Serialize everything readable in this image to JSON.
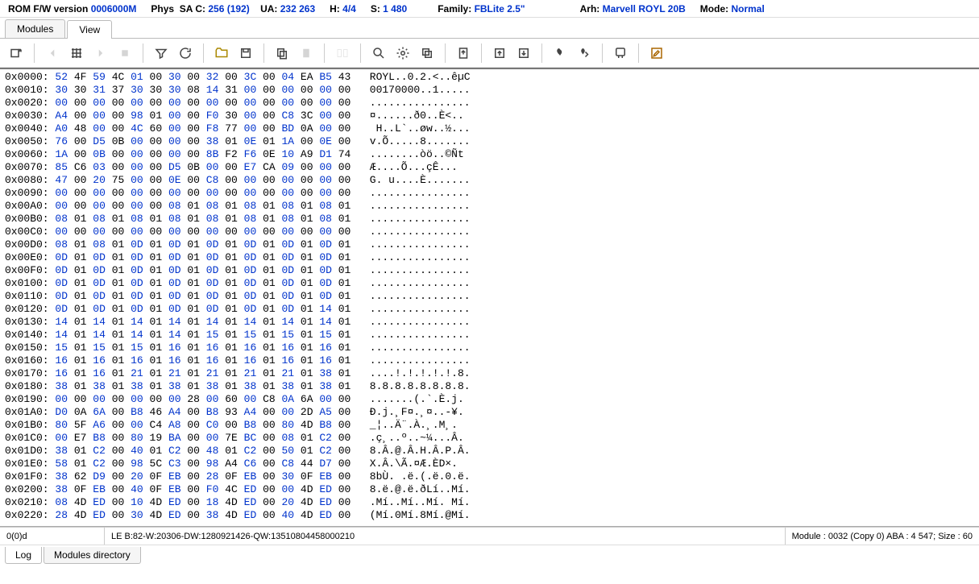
{
  "header": {
    "rom_label": "ROM F/W version",
    "rom_val": "0006000M",
    "phys_label": "Phys",
    "sa_c_label": "SA C:",
    "sa_c_val": "256 (192)",
    "ua_label": "UA:",
    "ua_val": "232 263",
    "h_label": "H:",
    "h_val": "4/4",
    "s_label": "S:",
    "s_val": "1 480",
    "family_label": "Family:",
    "family_val": "FBLite 2.5\"",
    "arh_label": "Arh:",
    "arh_val": "Marvell ROYL 20B",
    "mode_label": "Mode:",
    "mode_val": "Normal"
  },
  "tabs": {
    "modules": "Modules",
    "view": "View"
  },
  "hex_rows": [
    {
      "addr": "0x0000:",
      "bytes": [
        [
          "52",
          "4F"
        ],
        [
          "59",
          "4C"
        ],
        [
          "01",
          "00"
        ],
        [
          "30",
          "00"
        ],
        [
          "32",
          "00"
        ],
        [
          "3C",
          "00"
        ],
        [
          "04",
          "EA"
        ],
        [
          "B5",
          "43"
        ]
      ],
      "ascii": "ROYL..0.2.<..êµC"
    },
    {
      "addr": "0x0010:",
      "bytes": [
        [
          "30",
          "30"
        ],
        [
          "31",
          "37"
        ],
        [
          "30",
          "30"
        ],
        [
          "30",
          "08"
        ],
        [
          "14",
          "31"
        ],
        [
          "00",
          "00"
        ],
        [
          "00",
          "00"
        ],
        [
          "00",
          "00"
        ]
      ],
      "ascii": "00170000..1....."
    },
    {
      "addr": "0x0020:",
      "bytes": [
        [
          "00",
          "00"
        ],
        [
          "00",
          "00"
        ],
        [
          "00",
          "00"
        ],
        [
          "00",
          "00"
        ],
        [
          "00",
          "00"
        ],
        [
          "00",
          "00"
        ],
        [
          "00",
          "00"
        ],
        [
          "00",
          "00"
        ]
      ],
      "ascii": "................"
    },
    {
      "addr": "0x0030:",
      "bytes": [
        [
          "A4",
          "00"
        ],
        [
          "00",
          "00"
        ],
        [
          "98",
          "01"
        ],
        [
          "00",
          "00"
        ],
        [
          "F0",
          "30"
        ],
        [
          "00",
          "00"
        ],
        [
          "C8",
          "3C"
        ],
        [
          "00",
          "00"
        ]
      ],
      "ascii": "¤......ð0..È<.."
    },
    {
      "addr": "0x0040:",
      "bytes": [
        [
          "A0",
          "48"
        ],
        [
          "00",
          "00"
        ],
        [
          "4C",
          "60"
        ],
        [
          "00",
          "00"
        ],
        [
          "F8",
          "77"
        ],
        [
          "00",
          "00"
        ],
        [
          "BD",
          "0A"
        ],
        [
          "00",
          "00"
        ]
      ],
      "ascii": " H..L`..øw..½..."
    },
    {
      "addr": "0x0050:",
      "bytes": [
        [
          "76",
          "00"
        ],
        [
          "D5",
          "0B"
        ],
        [
          "00",
          "00"
        ],
        [
          "00",
          "00"
        ],
        [
          "38",
          "01"
        ],
        [
          "0E",
          "01"
        ],
        [
          "1A",
          "00"
        ],
        [
          "0E",
          "00"
        ]
      ],
      "ascii": "v.Õ.....8......."
    },
    {
      "addr": "0x0060:",
      "bytes": [
        [
          "1A",
          "00"
        ],
        [
          "0B",
          "00"
        ],
        [
          "00",
          "00"
        ],
        [
          "00",
          "00"
        ],
        [
          "8B",
          "F2"
        ],
        [
          "F6",
          "0E"
        ],
        [
          "10",
          "A9"
        ],
        [
          "D1",
          "74"
        ]
      ],
      "ascii": "........òö..©Ñt"
    },
    {
      "addr": "0x0070:",
      "bytes": [
        [
          "85",
          "C6"
        ],
        [
          "03",
          "00"
        ],
        [
          "00",
          "00"
        ],
        [
          "D5",
          "0B"
        ],
        [
          "00",
          "00"
        ],
        [
          "E7",
          "CA"
        ],
        [
          "09",
          "00"
        ],
        [
          "00",
          "00"
        ]
      ],
      "ascii": "Æ....Õ...çÊ..."
    },
    {
      "addr": "0x0080:",
      "bytes": [
        [
          "47",
          "00"
        ],
        [
          "20",
          "75"
        ],
        [
          "00",
          "00"
        ],
        [
          "0E",
          "00"
        ],
        [
          "C8",
          "00"
        ],
        [
          "00",
          "00"
        ],
        [
          "00",
          "00"
        ],
        [
          "00",
          "00"
        ]
      ],
      "ascii": "G. u....È......."
    },
    {
      "addr": "0x0090:",
      "bytes": [
        [
          "00",
          "00"
        ],
        [
          "00",
          "00"
        ],
        [
          "00",
          "00"
        ],
        [
          "00",
          "00"
        ],
        [
          "00",
          "00"
        ],
        [
          "00",
          "00"
        ],
        [
          "00",
          "00"
        ],
        [
          "00",
          "00"
        ]
      ],
      "ascii": "................"
    },
    {
      "addr": "0x00A0:",
      "bytes": [
        [
          "00",
          "00"
        ],
        [
          "00",
          "00"
        ],
        [
          "00",
          "00"
        ],
        [
          "08",
          "01"
        ],
        [
          "08",
          "01"
        ],
        [
          "08",
          "01"
        ],
        [
          "08",
          "01"
        ],
        [
          "08",
          "01"
        ]
      ],
      "ascii": "................"
    },
    {
      "addr": "0x00B0:",
      "bytes": [
        [
          "08",
          "01"
        ],
        [
          "08",
          "01"
        ],
        [
          "08",
          "01"
        ],
        [
          "08",
          "01"
        ],
        [
          "08",
          "01"
        ],
        [
          "08",
          "01"
        ],
        [
          "08",
          "01"
        ],
        [
          "08",
          "01"
        ]
      ],
      "ascii": "................"
    },
    {
      "addr": "0x00C0:",
      "bytes": [
        [
          "00",
          "00"
        ],
        [
          "00",
          "00"
        ],
        [
          "00",
          "00"
        ],
        [
          "00",
          "00"
        ],
        [
          "00",
          "00"
        ],
        [
          "00",
          "00"
        ],
        [
          "00",
          "00"
        ],
        [
          "00",
          "00"
        ]
      ],
      "ascii": "................"
    },
    {
      "addr": "0x00D0:",
      "bytes": [
        [
          "08",
          "01"
        ],
        [
          "08",
          "01"
        ],
        [
          "0D",
          "01"
        ],
        [
          "0D",
          "01"
        ],
        [
          "0D",
          "01"
        ],
        [
          "0D",
          "01"
        ],
        [
          "0D",
          "01"
        ],
        [
          "0D",
          "01"
        ]
      ],
      "ascii": "................"
    },
    {
      "addr": "0x00E0:",
      "bytes": [
        [
          "0D",
          "01"
        ],
        [
          "0D",
          "01"
        ],
        [
          "0D",
          "01"
        ],
        [
          "0D",
          "01"
        ],
        [
          "0D",
          "01"
        ],
        [
          "0D",
          "01"
        ],
        [
          "0D",
          "01"
        ],
        [
          "0D",
          "01"
        ]
      ],
      "ascii": "................"
    },
    {
      "addr": "0x00F0:",
      "bytes": [
        [
          "0D",
          "01"
        ],
        [
          "0D",
          "01"
        ],
        [
          "0D",
          "01"
        ],
        [
          "0D",
          "01"
        ],
        [
          "0D",
          "01"
        ],
        [
          "0D",
          "01"
        ],
        [
          "0D",
          "01"
        ],
        [
          "0D",
          "01"
        ]
      ],
      "ascii": "................"
    },
    {
      "addr": "0x0100:",
      "bytes": [
        [
          "0D",
          "01"
        ],
        [
          "0D",
          "01"
        ],
        [
          "0D",
          "01"
        ],
        [
          "0D",
          "01"
        ],
        [
          "0D",
          "01"
        ],
        [
          "0D",
          "01"
        ],
        [
          "0D",
          "01"
        ],
        [
          "0D",
          "01"
        ]
      ],
      "ascii": "................"
    },
    {
      "addr": "0x0110:",
      "bytes": [
        [
          "0D",
          "01"
        ],
        [
          "0D",
          "01"
        ],
        [
          "0D",
          "01"
        ],
        [
          "0D",
          "01"
        ],
        [
          "0D",
          "01"
        ],
        [
          "0D",
          "01"
        ],
        [
          "0D",
          "01"
        ],
        [
          "0D",
          "01"
        ]
      ],
      "ascii": "................"
    },
    {
      "addr": "0x0120:",
      "bytes": [
        [
          "0D",
          "01"
        ],
        [
          "0D",
          "01"
        ],
        [
          "0D",
          "01"
        ],
        [
          "0D",
          "01"
        ],
        [
          "0D",
          "01"
        ],
        [
          "0D",
          "01"
        ],
        [
          "0D",
          "01"
        ],
        [
          "14",
          "01"
        ]
      ],
      "ascii": "................"
    },
    {
      "addr": "0x0130:",
      "bytes": [
        [
          "14",
          "01"
        ],
        [
          "14",
          "01"
        ],
        [
          "14",
          "01"
        ],
        [
          "14",
          "01"
        ],
        [
          "14",
          "01"
        ],
        [
          "14",
          "01"
        ],
        [
          "14",
          "01"
        ],
        [
          "14",
          "01"
        ]
      ],
      "ascii": "................"
    },
    {
      "addr": "0x0140:",
      "bytes": [
        [
          "14",
          "01"
        ],
        [
          "14",
          "01"
        ],
        [
          "14",
          "01"
        ],
        [
          "14",
          "01"
        ],
        [
          "15",
          "01"
        ],
        [
          "15",
          "01"
        ],
        [
          "15",
          "01"
        ],
        [
          "15",
          "01"
        ]
      ],
      "ascii": "................"
    },
    {
      "addr": "0x0150:",
      "bytes": [
        [
          "15",
          "01"
        ],
        [
          "15",
          "01"
        ],
        [
          "15",
          "01"
        ],
        [
          "16",
          "01"
        ],
        [
          "16",
          "01"
        ],
        [
          "16",
          "01"
        ],
        [
          "16",
          "01"
        ],
        [
          "16",
          "01"
        ]
      ],
      "ascii": "................"
    },
    {
      "addr": "0x0160:",
      "bytes": [
        [
          "16",
          "01"
        ],
        [
          "16",
          "01"
        ],
        [
          "16",
          "01"
        ],
        [
          "16",
          "01"
        ],
        [
          "16",
          "01"
        ],
        [
          "16",
          "01"
        ],
        [
          "16",
          "01"
        ],
        [
          "16",
          "01"
        ]
      ],
      "ascii": "................"
    },
    {
      "addr": "0x0170:",
      "bytes": [
        [
          "16",
          "01"
        ],
        [
          "16",
          "01"
        ],
        [
          "21",
          "01"
        ],
        [
          "21",
          "01"
        ],
        [
          "21",
          "01"
        ],
        [
          "21",
          "01"
        ],
        [
          "21",
          "01"
        ],
        [
          "38",
          "01"
        ]
      ],
      "ascii": "....!.!.!.!.!.8."
    },
    {
      "addr": "0x0180:",
      "bytes": [
        [
          "38",
          "01"
        ],
        [
          "38",
          "01"
        ],
        [
          "38",
          "01"
        ],
        [
          "38",
          "01"
        ],
        [
          "38",
          "01"
        ],
        [
          "38",
          "01"
        ],
        [
          "38",
          "01"
        ],
        [
          "38",
          "01"
        ]
      ],
      "ascii": "8.8.8.8.8.8.8.8."
    },
    {
      "addr": "0x0190:",
      "bytes": [
        [
          "00",
          "00"
        ],
        [
          "00",
          "00"
        ],
        [
          "00",
          "00"
        ],
        [
          "00",
          "28"
        ],
        [
          "00",
          "60"
        ],
        [
          "00",
          "C8"
        ],
        [
          "0A",
          "6A"
        ],
        [
          "00",
          "00"
        ]
      ],
      "ascii": ".......(.`.È.j."
    },
    {
      "addr": "0x01A0:",
      "bytes": [
        [
          "D0",
          "0A"
        ],
        [
          "6A",
          "00"
        ],
        [
          "B8",
          "46"
        ],
        [
          "A4",
          "00"
        ],
        [
          "B8",
          "93"
        ],
        [
          "A4",
          "00"
        ],
        [
          "00",
          "2D"
        ],
        [
          "A5",
          "00"
        ]
      ],
      "ascii": "Ð.j.¸F¤.¸¤..-¥."
    },
    {
      "addr": "0x01B0:",
      "bytes": [
        [
          "80",
          "5F"
        ],
        [
          "A6",
          "00"
        ],
        [
          "00",
          "C4"
        ],
        [
          "A8",
          "00"
        ],
        [
          "C0",
          "00"
        ],
        [
          "B8",
          "00"
        ],
        [
          "80",
          "4D"
        ],
        [
          "B8",
          "00"
        ]
      ],
      "ascii": "_¦..Ä¨.À.¸.M¸."
    },
    {
      "addr": "0x01C0:",
      "bytes": [
        [
          "00",
          "E7"
        ],
        [
          "B8",
          "00"
        ],
        [
          "80",
          "19"
        ],
        [
          "BA",
          "00"
        ],
        [
          "00",
          "7E"
        ],
        [
          "BC",
          "00"
        ],
        [
          "08",
          "01"
        ],
        [
          "C2",
          "00"
        ]
      ],
      "ascii": ".ç¸..º..~¼...Â."
    },
    {
      "addr": "0x01D0:",
      "bytes": [
        [
          "38",
          "01"
        ],
        [
          "C2",
          "00"
        ],
        [
          "40",
          "01"
        ],
        [
          "C2",
          "00"
        ],
        [
          "48",
          "01"
        ],
        [
          "C2",
          "00"
        ],
        [
          "50",
          "01"
        ],
        [
          "C2",
          "00"
        ]
      ],
      "ascii": "8.Â.@.Â.H.Â.P.Â."
    },
    {
      "addr": "0x01E0:",
      "bytes": [
        [
          "58",
          "01"
        ],
        [
          "C2",
          "00"
        ],
        [
          "98",
          "5C"
        ],
        [
          "C3",
          "00"
        ],
        [
          "98",
          "A4"
        ],
        [
          "C6",
          "00"
        ],
        [
          "C8",
          "44"
        ],
        [
          "D7",
          "00"
        ]
      ],
      "ascii": "X.Â.\\Ã.¤Æ.ÈD×."
    },
    {
      "addr": "0x01F0:",
      "bytes": [
        [
          "38",
          "62"
        ],
        [
          "D9",
          "00"
        ],
        [
          "20",
          "0F"
        ],
        [
          "EB",
          "00"
        ],
        [
          "28",
          "0F"
        ],
        [
          "EB",
          "00"
        ],
        [
          "30",
          "0F"
        ],
        [
          "EB",
          "00"
        ]
      ],
      "ascii": "8bÙ. .ë.(.ë.0.ë."
    },
    {
      "addr": "0x0200:",
      "bytes": [
        [
          "38",
          "0F"
        ],
        [
          "EB",
          "00"
        ],
        [
          "40",
          "0F"
        ],
        [
          "EB",
          "00"
        ],
        [
          "F0",
          "4C"
        ],
        [
          "ED",
          "00"
        ],
        [
          "00",
          "4D"
        ],
        [
          "ED",
          "00"
        ]
      ],
      "ascii": "8.ë.@.ë.ðLí..Mí."
    },
    {
      "addr": "0x0210:",
      "bytes": [
        [
          "08",
          "4D"
        ],
        [
          "ED",
          "00"
        ],
        [
          "10",
          "4D"
        ],
        [
          "ED",
          "00"
        ],
        [
          "18",
          "4D"
        ],
        [
          "ED",
          "00"
        ],
        [
          "20",
          "4D"
        ],
        [
          "ED",
          "00"
        ]
      ],
      "ascii": ".Mí..Mí..Mí. Mí."
    },
    {
      "addr": "0x0220:",
      "bytes": [
        [
          "28",
          "4D"
        ],
        [
          "ED",
          "00"
        ],
        [
          "30",
          "4D"
        ],
        [
          "ED",
          "00"
        ],
        [
          "38",
          "4D"
        ],
        [
          "ED",
          "00"
        ],
        [
          "40",
          "4D"
        ],
        [
          "ED",
          "00"
        ]
      ],
      "ascii": "(Mí.0Mí.8Mí.@Mí."
    }
  ],
  "status": {
    "left": "0(0)d",
    "mid": "LE B:82-W:20306-DW:1280921426-QW:13510804458000210",
    "right": "Module : 0032 (Copy 0) ABA : 4 547; Size : 60"
  },
  "bottom_tabs": {
    "log": "Log",
    "moddir": "Modules directory"
  }
}
